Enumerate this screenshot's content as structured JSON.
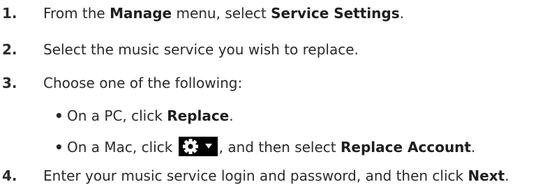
{
  "steps": [
    {
      "number": "1.",
      "parts": [
        "From the ",
        "Manage",
        " menu, select ",
        "Service Settings",
        "."
      ]
    },
    {
      "number": "2.",
      "text": "Select the music service you wish to replace."
    },
    {
      "number": "3.",
      "text": "Choose one of the following:",
      "bullets": [
        {
          "parts": [
            "On a PC, click ",
            "Replace",
            "."
          ]
        },
        {
          "parts": [
            "On a Mac, click ",
            ", and then select ",
            "Replace Account",
            "."
          ],
          "icon": "gear-dropdown-icon"
        }
      ]
    },
    {
      "number": "4.",
      "parts": [
        "Enter your music service login and password, and then click ",
        "Next",
        "."
      ]
    }
  ],
  "bullet_char": "•",
  "colors": {
    "text": "#2a2a2a",
    "icon_bg": "#000000",
    "icon_fg": "#ffffff"
  }
}
